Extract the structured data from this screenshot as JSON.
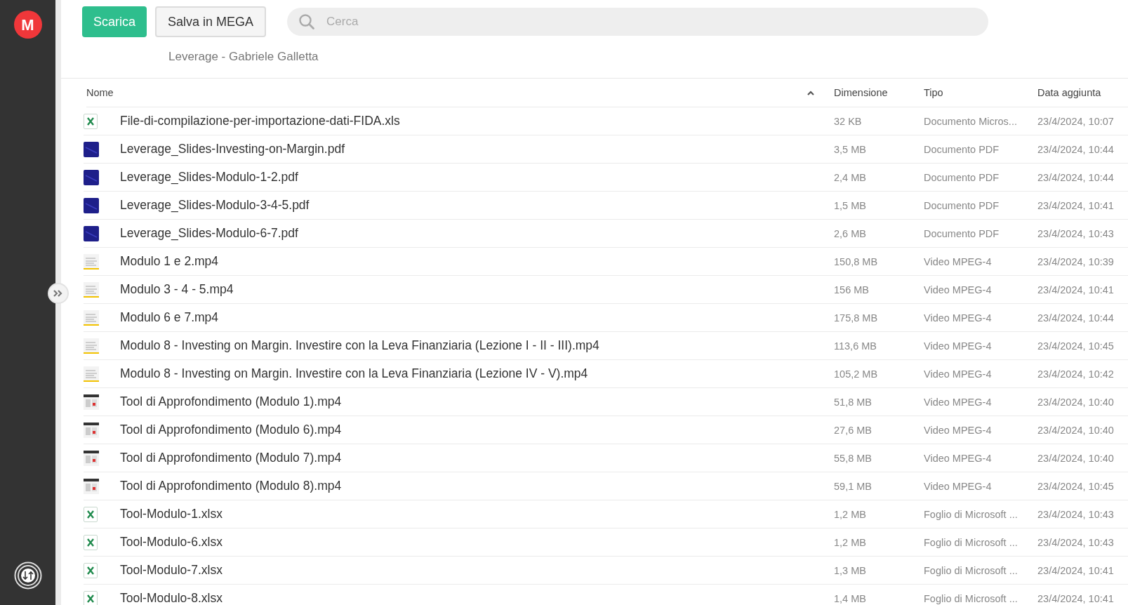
{
  "sidebar": {
    "logo": "M"
  },
  "toolbar": {
    "buttons": [
      {
        "label": "Scarica",
        "kind": "primary"
      },
      {
        "label": "Salva in MEGA",
        "kind": "secondary"
      }
    ],
    "search": {
      "placeholder": "Cerca"
    }
  },
  "folder_title": "Leverage - Gabriele Galletta",
  "table": {
    "columns": [
      {
        "label": "Nome",
        "sorted": true
      },
      {
        "label": "Dimensione"
      },
      {
        "label": "Tipo"
      },
      {
        "label": "Data aggiunta"
      }
    ],
    "rows": [
      {
        "kind": "excel",
        "name": "File-di-compilazione-per-importazione-dati-FIDA.xls",
        "size": "32 KB",
        "type": "Documento Micros...",
        "added": "23/4/2024, 10:07"
      },
      {
        "kind": "pdf",
        "name": "Leverage_Slides-Investing-on-Margin.pdf",
        "size": "3,5 MB",
        "type": "Documento PDF",
        "added": "23/4/2024, 10:44"
      },
      {
        "kind": "pdf",
        "name": "Leverage_Slides-Modulo-1-2.pdf",
        "size": "2,4 MB",
        "type": "Documento PDF",
        "added": "23/4/2024, 10:44"
      },
      {
        "kind": "pdf",
        "name": "Leverage_Slides-Modulo-3-4-5.pdf",
        "size": "1,5 MB",
        "type": "Documento PDF",
        "added": "23/4/2024, 10:41"
      },
      {
        "kind": "pdf",
        "name": "Leverage_Slides-Modulo-6-7.pdf",
        "size": "2,6 MB",
        "type": "Documento PDF",
        "added": "23/4/2024, 10:43"
      },
      {
        "kind": "video",
        "name": "Modulo 1 e 2.mp4",
        "size": "150,8 MB",
        "type": "Video MPEG-4",
        "added": "23/4/2024, 10:39"
      },
      {
        "kind": "video",
        "name": "Modulo 3 - 4 - 5.mp4",
        "size": "156 MB",
        "type": "Video MPEG-4",
        "added": "23/4/2024, 10:41"
      },
      {
        "kind": "video",
        "name": "Modulo 6 e 7.mp4",
        "size": "175,8 MB",
        "type": "Video MPEG-4",
        "added": "23/4/2024, 10:44"
      },
      {
        "kind": "video",
        "name": "Modulo 8 - Investing on Margin. Investire con la Leva Finanziaria (Lezione I - II - III).mp4",
        "size": "113,6 MB",
        "type": "Video MPEG-4",
        "added": "23/4/2024, 10:45"
      },
      {
        "kind": "video",
        "name": "Modulo 8 - Investing on Margin. Investire con la Leva Finanziaria (Lezione IV - V).mp4",
        "size": "105,2 MB",
        "type": "Video MPEG-4",
        "added": "23/4/2024, 10:42"
      },
      {
        "kind": "video",
        "name": "Tool di Approfondimento (Modulo 1).mp4",
        "size": "51,8 MB",
        "type": "Video MPEG-4",
        "added": "23/4/2024, 10:40"
      },
      {
        "kind": "video",
        "name": "Tool di Approfondimento (Modulo 6).mp4",
        "size": "27,6 MB",
        "type": "Video MPEG-4",
        "added": "23/4/2024, 10:40"
      },
      {
        "kind": "video",
        "name": "Tool di Approfondimento (Modulo 7).mp4",
        "size": "55,8 MB",
        "type": "Video MPEG-4",
        "added": "23/4/2024, 10:40"
      },
      {
        "kind": "video",
        "name": "Tool di Approfondimento (Modulo 8).mp4",
        "size": "59,1 MB",
        "type": "Video MPEG-4",
        "added": "23/4/2024, 10:45"
      },
      {
        "kind": "excel",
        "name": "Tool-Modulo-1.xlsx",
        "size": "1,2 MB",
        "type": "Foglio di Microsoft ...",
        "added": "23/4/2024, 10:43"
      },
      {
        "kind": "excel",
        "name": "Tool-Modulo-6.xlsx",
        "size": "1,2 MB",
        "type": "Foglio di Microsoft ...",
        "added": "23/4/2024, 10:43"
      },
      {
        "kind": "excel",
        "name": "Tool-Modulo-7.xlsx",
        "size": "1,3 MB",
        "type": "Foglio di Microsoft ...",
        "added": "23/4/2024, 10:41"
      },
      {
        "kind": "excel",
        "name": "Tool-Modulo-8.xlsx",
        "size": "1,4 MB",
        "type": "Foglio di Microsoft ...",
        "added": "23/4/2024, 10:41"
      }
    ]
  }
}
